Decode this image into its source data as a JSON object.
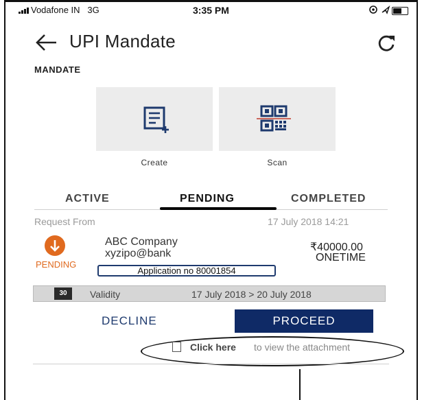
{
  "status_bar": {
    "carrier": "Vodafone IN",
    "network": "3G",
    "time": "3:35 PM",
    "icons": [
      "signal-icon",
      "location-icon",
      "battery-icon"
    ]
  },
  "header": {
    "title": "UPI Mandate",
    "back_icon": "arrow-left-icon",
    "refresh_icon": "refresh-icon"
  },
  "section_label": "MANDATE",
  "actions": [
    {
      "label": "Create",
      "icon": "create-document-icon"
    },
    {
      "label": "Scan",
      "icon": "qr-scan-icon"
    }
  ],
  "tabs": [
    {
      "label": "ACTIVE"
    },
    {
      "label": "PENDING",
      "selected": true
    },
    {
      "label": "COMPLETED"
    }
  ],
  "request": {
    "label": "Request From",
    "datetime": "17 July 2018 14:21",
    "status": "PENDING",
    "status_icon": "arrow-down-icon",
    "status_color": "#e06a1f",
    "company": "ABC Company",
    "upi_id": "xyzipo@bank",
    "amount": "₹40000.00",
    "amount_type": "ONETIME",
    "application_no": "Application no 80001854"
  },
  "validity": {
    "calendar_day": "30",
    "label": "Validity",
    "dates": "17 July 2018 > 20 July 2018"
  },
  "buttons": {
    "decline": "DECLINE",
    "proceed": "PROCEED",
    "proceed_color": "#0f2a66"
  },
  "attachment": {
    "link_text": "Click here",
    "rest_text": "to view the attachment"
  }
}
